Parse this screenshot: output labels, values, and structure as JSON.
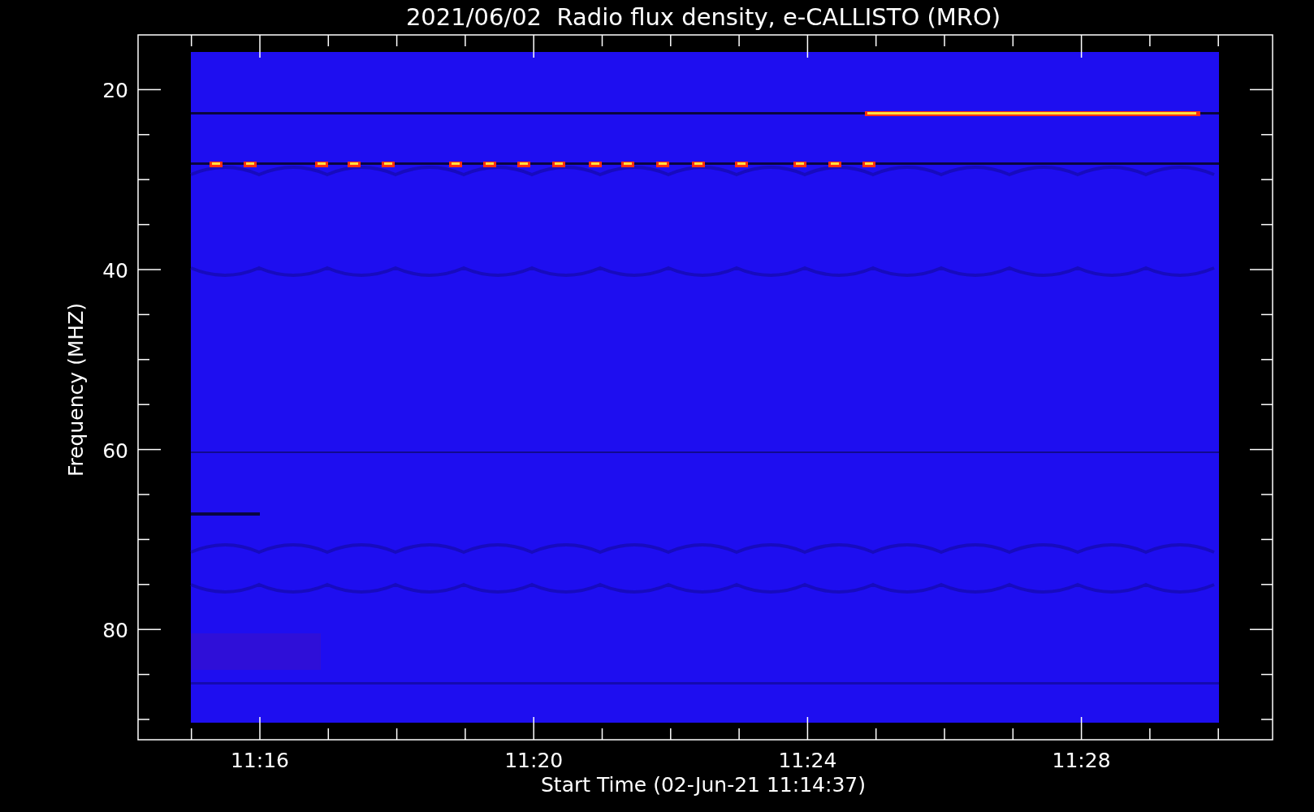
{
  "plot": {
    "title": "2021/06/02  Radio flux density, e-CALLISTO (MRO)",
    "xlabel": "Start Time (02-Jun-21 11:14:37)",
    "ylabel": "Frequency (MHZ)",
    "xtick_labels": [
      "11:16",
      "11:20",
      "11:24",
      "11:28"
    ],
    "ytick_labels": [
      "20",
      "40",
      "60",
      "80"
    ]
  }
}
